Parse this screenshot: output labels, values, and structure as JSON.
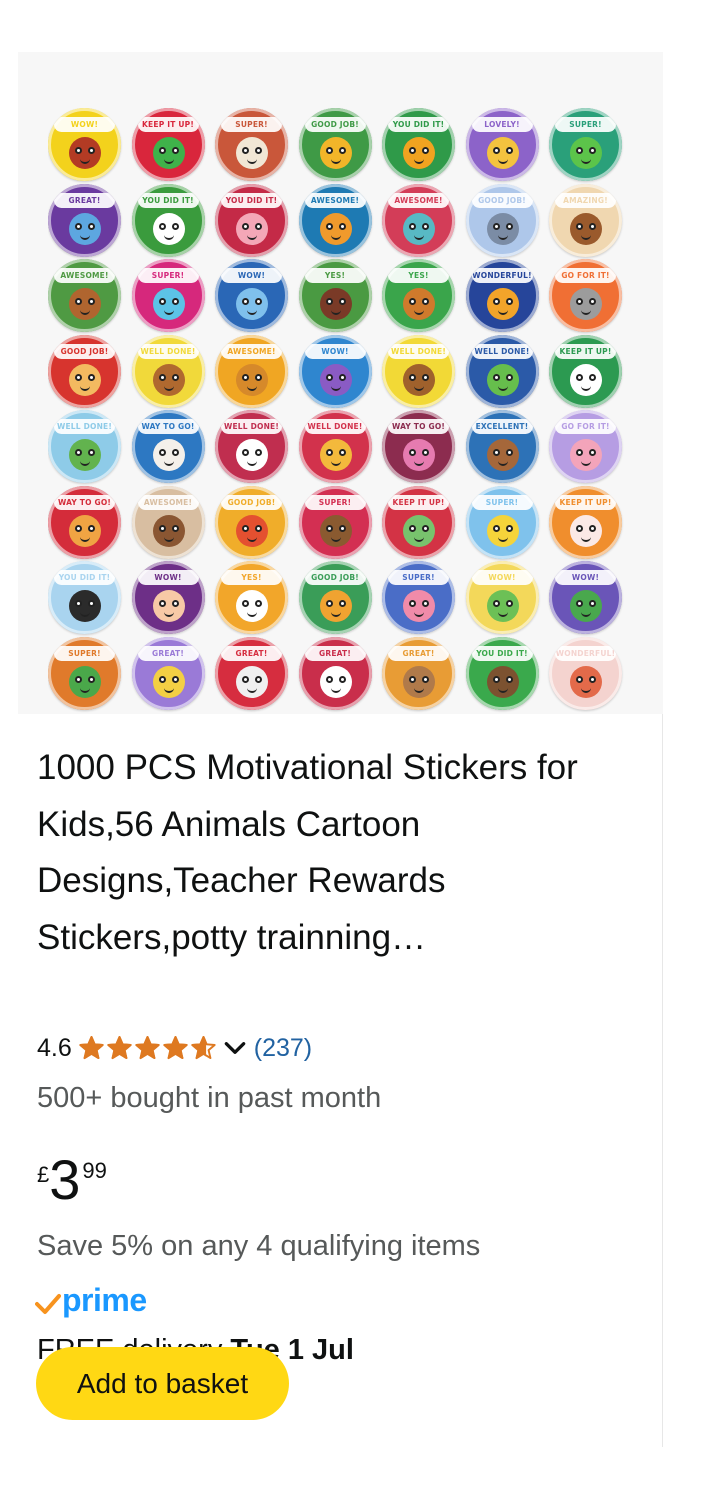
{
  "product": {
    "title": "1000 PCS Motivational Stickers for Kids,56 Animals Cartoon Designs,Teacher Rewards Stickers,potty trainning…",
    "rating_value": "4.6",
    "rating_stars": 4.6,
    "review_count": "(237)",
    "bought_text": "500+ bought in past month",
    "price": {
      "currency": "£",
      "whole": "3",
      "fraction": "99"
    },
    "savings_text": "Save 5% on any 4 qualifying items",
    "prime_label": "prime",
    "delivery_prefix": "FREE delivery ",
    "delivery_date": "Tue 1 Jul",
    "add_to_basket_label": "Add to basket"
  },
  "image": {
    "stickers": [
      {
        "text": "WOW!",
        "bg": "#f3d21c",
        "face": "#b33b24"
      },
      {
        "text": "KEEP IT UP!",
        "bg": "#d9263c",
        "face": "#3fb24a"
      },
      {
        "text": "SUPER!",
        "bg": "#c9573a",
        "face": "#f1e7d5"
      },
      {
        "text": "GOOD JOB!",
        "bg": "#3f9a46",
        "face": "#f2b529"
      },
      {
        "text": "YOU DID IT!",
        "bg": "#2f9a49",
        "face": "#f1a320"
      },
      {
        "text": "LOVELY!",
        "bg": "#8c63c9",
        "face": "#f4c33f"
      },
      {
        "text": "SUPER!",
        "bg": "#2aa07a",
        "face": "#5cc44a"
      },
      {
        "text": "GREAT!",
        "bg": "#6a3a9f",
        "face": "#5da7e0"
      },
      {
        "text": "YOU DID IT!",
        "bg": "#3a9b3d",
        "face": "#ffffff"
      },
      {
        "text": "YOU DID IT!",
        "bg": "#c42a47",
        "face": "#f4a7b7"
      },
      {
        "text": "AWESOME!",
        "bg": "#1e7ab3",
        "face": "#f09a2c"
      },
      {
        "text": "AWESOME!",
        "bg": "#d33d58",
        "face": "#58b9c4"
      },
      {
        "text": "GOOD JOB!",
        "bg": "#aec7ea",
        "face": "#7b8ca5"
      },
      {
        "text": "AMAZING!",
        "bg": "#f0d7b0",
        "face": "#9a5a2c"
      },
      {
        "text": "AWESOME!",
        "bg": "#4f9a43",
        "face": "#b0652f"
      },
      {
        "text": "SUPER!",
        "bg": "#d6287c",
        "face": "#5cc3e6"
      },
      {
        "text": "WOW!",
        "bg": "#2a67b6",
        "face": "#7fc0ec"
      },
      {
        "text": "YES!",
        "bg": "#4a9a42",
        "face": "#7a3a27"
      },
      {
        "text": "YES!",
        "bg": "#3aa54b",
        "face": "#d07a2c"
      },
      {
        "text": "WONDERFUL!",
        "bg": "#26459a",
        "face": "#f2a42a"
      },
      {
        "text": "GO FOR IT!",
        "bg": "#f06f34",
        "face": "#9c9c9c"
      },
      {
        "text": "GOOD JOB!",
        "bg": "#d7342e",
        "face": "#f3ba60"
      },
      {
        "text": "WELL DONE!",
        "bg": "#f1d93a",
        "face": "#b0692f"
      },
      {
        "text": "AWESOME!",
        "bg": "#f0a623",
        "face": "#d6892a"
      },
      {
        "text": "WOW!",
        "bg": "#2f86cf",
        "face": "#8a5bc4"
      },
      {
        "text": "WELL DONE!",
        "bg": "#f2d936",
        "face": "#a0612c"
      },
      {
        "text": "WELL DONE!",
        "bg": "#2b5aa8",
        "face": "#66be4c"
      },
      {
        "text": "KEEP IT UP!",
        "bg": "#2c9a51",
        "face": "#ffffff"
      },
      {
        "text": "WELL DONE!",
        "bg": "#8ecbe8",
        "face": "#62b34e"
      },
      {
        "text": "WAY TO GO!",
        "bg": "#2d78c2",
        "face": "#f4f0ea"
      },
      {
        "text": "WELL DONE!",
        "bg": "#c02e4f",
        "face": "#ffffff"
      },
      {
        "text": "WELL DONE!",
        "bg": "#d2324c",
        "face": "#f3b93c"
      },
      {
        "text": "WAY TO GO!",
        "bg": "#8c2c4f",
        "face": "#e67bb0"
      },
      {
        "text": "EXCELLENT!",
        "bg": "#2d72b7",
        "face": "#a5673a"
      },
      {
        "text": "GO FOR IT!",
        "bg": "#b69de3",
        "face": "#f3a4ba"
      },
      {
        "text": "WAY TO GO!",
        "bg": "#d42c3a",
        "face": "#f0a443"
      },
      {
        "text": "AWESOME!",
        "bg": "#d8bea1",
        "face": "#8a5632"
      },
      {
        "text": "GOOD JOB!",
        "bg": "#f0ad2a",
        "face": "#e45030"
      },
      {
        "text": "SUPER!",
        "bg": "#d32f52",
        "face": "#8a5a30"
      },
      {
        "text": "KEEP IT UP!",
        "bg": "#d33345",
        "face": "#78c36d"
      },
      {
        "text": "SUPER!",
        "bg": "#7fc2ec",
        "face": "#f5d43a"
      },
      {
        "text": "KEEP IT UP!",
        "bg": "#f08e2d",
        "face": "#fbe9e6"
      },
      {
        "text": "YOU DID IT!",
        "bg": "#a9d4ef",
        "face": "#2b2b2b"
      },
      {
        "text": "WOW!",
        "bg": "#6d2f87",
        "face": "#f7c9a6"
      },
      {
        "text": "YES!",
        "bg": "#f2a62a",
        "face": "#ffffff"
      },
      {
        "text": "GOOD JOB!",
        "bg": "#3a9d58",
        "face": "#f0a331"
      },
      {
        "text": "SUPER!",
        "bg": "#4a6dc7",
        "face": "#f08ba9"
      },
      {
        "text": "WOW!",
        "bg": "#f3d85a",
        "face": "#6cc056"
      },
      {
        "text": "WOW!",
        "bg": "#6a55b8",
        "face": "#49a84d"
      },
      {
        "text": "SUPER!",
        "bg": "#e07a2b",
        "face": "#4aa84a"
      },
      {
        "text": "GREAT!",
        "bg": "#9a7ad7",
        "face": "#f3cf44"
      },
      {
        "text": "GREAT!",
        "bg": "#d62d3f",
        "face": "#f0f0f0"
      },
      {
        "text": "GREAT!",
        "bg": "#c92e4b",
        "face": "#ffffff"
      },
      {
        "text": "GREAT!",
        "bg": "#e89c35",
        "face": "#b07a4a"
      },
      {
        "text": "YOU DID IT!",
        "bg": "#3aa94c",
        "face": "#7c5230"
      },
      {
        "text": "WONDERFUL!",
        "bg": "#f4d3cf",
        "face": "#e36a4a"
      }
    ]
  },
  "colors": {
    "accent_button": "#ffd814",
    "star": "#de7921",
    "link": "#2162a1",
    "prime": "#1a98ff",
    "prime_check": "#f7931e"
  }
}
